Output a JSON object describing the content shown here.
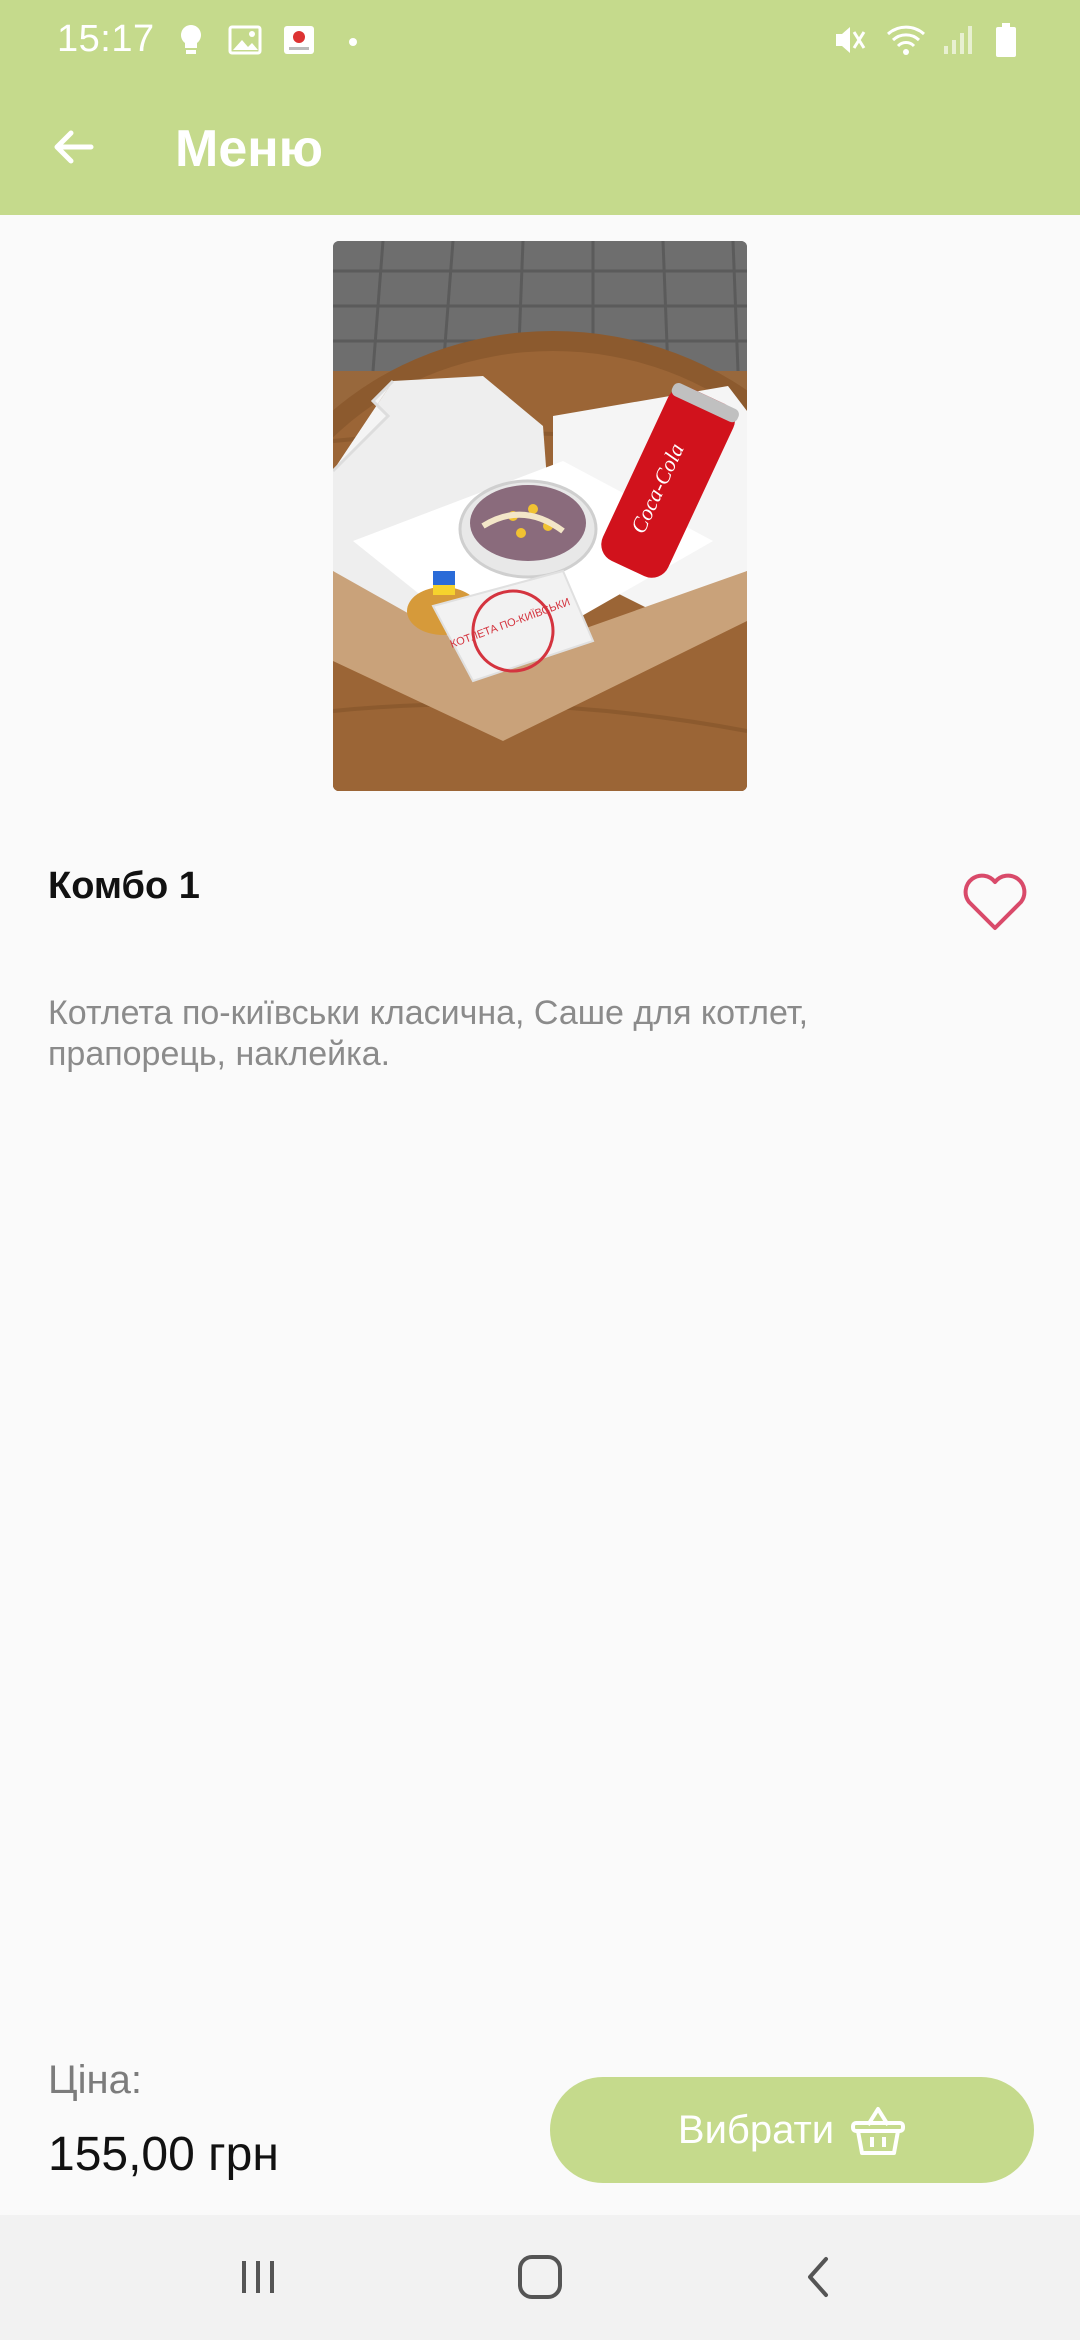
{
  "status_bar": {
    "time": "15:17",
    "icons": [
      "bulb-icon",
      "gallery-icon",
      "app-notification-icon",
      "dot-icon",
      "mute-icon",
      "wifi-icon",
      "signal-icon",
      "battery-icon"
    ]
  },
  "app_bar": {
    "title": "Меню",
    "back_icon": "arrow-left-icon"
  },
  "product": {
    "name": "Комбо 1",
    "description": "Котлета по-київськи класична, Саше для котлет, прапорець, наклейка.",
    "favorite_icon": "heart-outline-icon",
    "image_text": {
      "sticker": "КОТЛЕТА ПО-КИЇВСЬКИ",
      "can": "Coca-Cola"
    }
  },
  "footer": {
    "price_label": "Ціна:",
    "price_value": "155,00 грн",
    "select_label": "Вибрати",
    "select_icon": "basket-icon"
  },
  "colors": {
    "accent": "#c5da8c",
    "heart": "#d94a6a",
    "text_primary": "#111111",
    "text_secondary": "#8b8b8b"
  },
  "nav_bar": {
    "icons": [
      "recent-apps-icon",
      "home-icon",
      "back-icon"
    ]
  }
}
